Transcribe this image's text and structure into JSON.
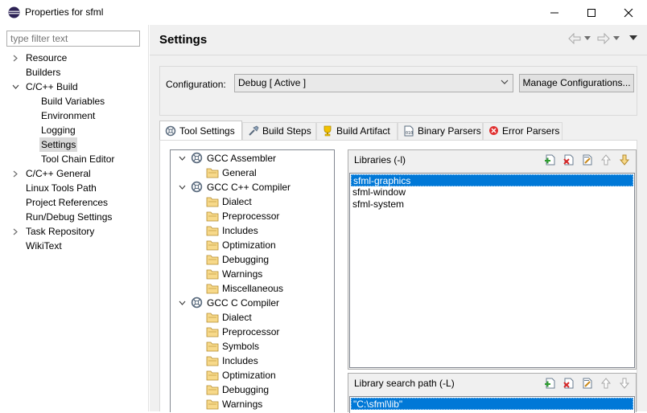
{
  "window": {
    "title": "Properties for sfml"
  },
  "sidebar": {
    "filter_placeholder": "type filter text",
    "items": [
      {
        "label": "Resource",
        "expandable": true,
        "expanded": false
      },
      {
        "label": "Builders"
      },
      {
        "label": "C/C++ Build",
        "expandable": true,
        "expanded": true
      },
      {
        "label": "Build Variables"
      },
      {
        "label": "Environment"
      },
      {
        "label": "Logging"
      },
      {
        "label": "Settings",
        "selected": true
      },
      {
        "label": "Tool Chain Editor"
      },
      {
        "label": "C/C++ General",
        "expandable": true,
        "expanded": false
      },
      {
        "label": "Linux Tools Path"
      },
      {
        "label": "Project References"
      },
      {
        "label": "Run/Debug Settings"
      },
      {
        "label": "Task Repository",
        "expandable": true,
        "expanded": false
      },
      {
        "label": "WikiText"
      }
    ]
  },
  "main": {
    "title": "Settings",
    "configuration": {
      "label": "Configuration:",
      "value": "Debug  [ Active ]",
      "manage_label": "Manage Configurations..."
    },
    "tabs": [
      {
        "label": "Tool Settings",
        "icon": "tool-settings-icon",
        "active": true
      },
      {
        "label": "Build Steps",
        "icon": "build-steps-icon"
      },
      {
        "label": "Build Artifact",
        "icon": "build-artifact-icon"
      },
      {
        "label": "Binary Parsers",
        "icon": "binary-parsers-icon"
      },
      {
        "label": "Error Parsers",
        "icon": "error-parsers-icon"
      }
    ],
    "tool_tree": [
      {
        "label": "GCC Assembler",
        "level": 0
      },
      {
        "label": "General",
        "level": 1
      },
      {
        "label": "GCC C++ Compiler",
        "level": 0
      },
      {
        "label": "Dialect",
        "level": 1
      },
      {
        "label": "Preprocessor",
        "level": 1
      },
      {
        "label": "Includes",
        "level": 1
      },
      {
        "label": "Optimization",
        "level": 1
      },
      {
        "label": "Debugging",
        "level": 1
      },
      {
        "label": "Warnings",
        "level": 1
      },
      {
        "label": "Miscellaneous",
        "level": 1
      },
      {
        "label": "GCC C Compiler",
        "level": 0
      },
      {
        "label": "Dialect",
        "level": 1
      },
      {
        "label": "Preprocessor",
        "level": 1
      },
      {
        "label": "Symbols",
        "level": 1
      },
      {
        "label": "Includes",
        "level": 1
      },
      {
        "label": "Optimization",
        "level": 1
      },
      {
        "label": "Debugging",
        "level": 1
      },
      {
        "label": "Warnings",
        "level": 1
      }
    ],
    "libraries": {
      "title": "Libraries (-l)",
      "items": [
        {
          "label": "sfml-graphics",
          "selected": true
        },
        {
          "label": "sfml-window"
        },
        {
          "label": "sfml-system"
        }
      ]
    },
    "library_search_path": {
      "title": "Library search path (-L)",
      "items": [
        {
          "label": "\"C:\\sfml\\lib\"",
          "selected": true
        }
      ]
    }
  },
  "colors": {
    "selection": "#0078d7",
    "sidebar_selection": "#d9d9d9",
    "panel_bg": "#f0f0f0",
    "brand": "#2c2255"
  }
}
